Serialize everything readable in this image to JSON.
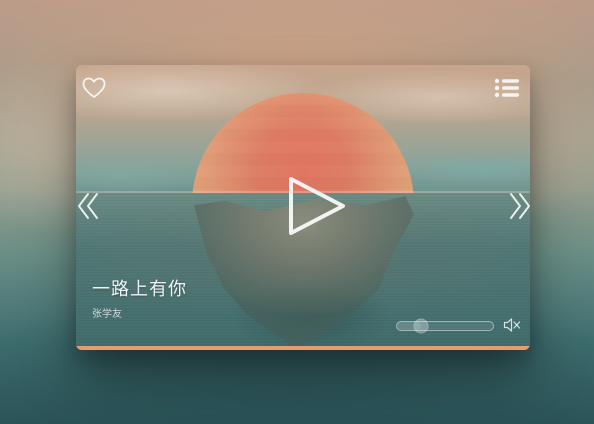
{
  "song": {
    "title": "一路上有你",
    "artist": "张学友"
  },
  "controls": {
    "favorite_icon": "heart-icon",
    "playlist_icon": "list-icon",
    "prev_icon": "double-chevron-left-icon",
    "next_icon": "double-chevron-right-icon",
    "play_icon": "play-icon",
    "mute_icon": "speaker-muted-icon"
  },
  "volume": {
    "level": 0.25
  },
  "colors": {
    "accent": "#e89a72",
    "sun": "#e5715c",
    "teal": "#3c6f70"
  }
}
